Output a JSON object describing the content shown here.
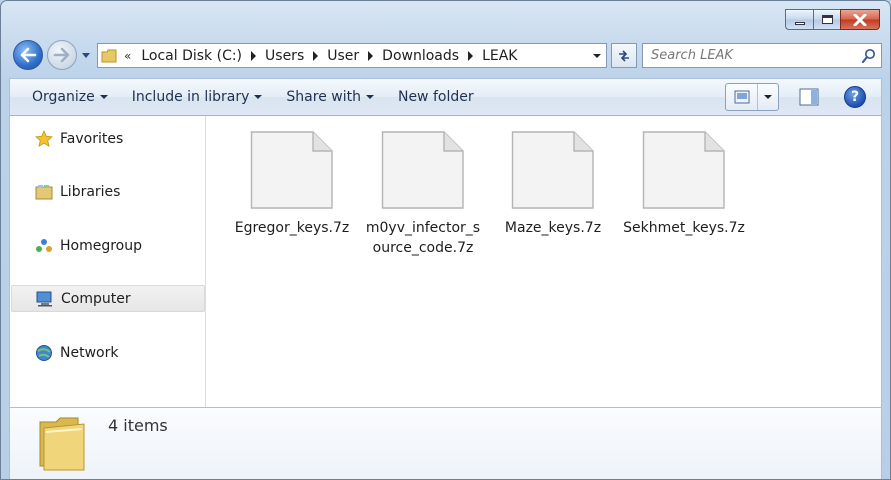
{
  "window": {
    "caption": {
      "minimize": "minimize-icon",
      "maximize": "maximize-icon",
      "close": "close-icon"
    }
  },
  "address_bar": {
    "overflow_chevron": "«",
    "breadcrumbs": [
      "Local Disk (C:)",
      "Users",
      "User",
      "Downloads",
      "LEAK"
    ]
  },
  "search": {
    "placeholder": "Search LEAK"
  },
  "toolbar": {
    "organize": "Organize",
    "include_in_library": "Include in library",
    "share_with": "Share with",
    "new_folder": "New folder",
    "help": "?"
  },
  "nav": {
    "items": [
      {
        "label": "Favorites",
        "icon": "star-icon"
      },
      {
        "label": "Libraries",
        "icon": "libraries-icon"
      },
      {
        "label": "Homegroup",
        "icon": "homegroup-icon"
      },
      {
        "label": "Computer",
        "icon": "computer-icon",
        "selected": true
      },
      {
        "label": "Network",
        "icon": "network-icon"
      }
    ]
  },
  "files": [
    {
      "name": "Egregor_keys.7z",
      "icon": "file-icon"
    },
    {
      "name": "m0yv_infector_source_code.7z",
      "icon": "file-icon"
    },
    {
      "name": "Maze_keys.7z",
      "icon": "file-icon"
    },
    {
      "name": "Sekhmet_keys.7z",
      "icon": "file-icon"
    }
  ],
  "details": {
    "count": "4 items"
  },
  "colors": {
    "accent": "#2f6fc9",
    "close": "#c23a1f",
    "chrome": "#bcd2e9"
  }
}
